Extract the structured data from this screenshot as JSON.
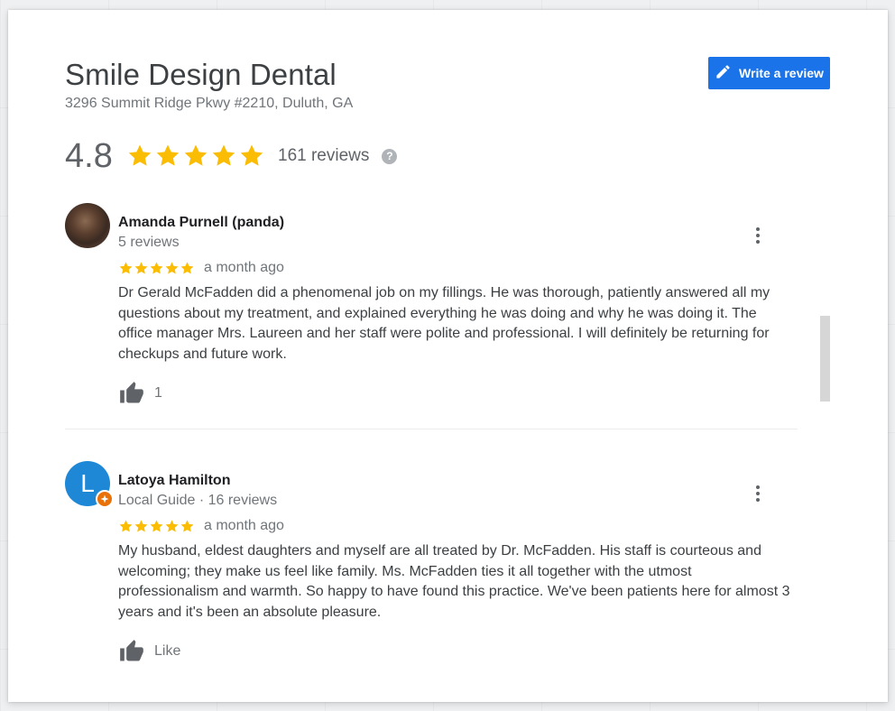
{
  "place": {
    "name": "Smile Design Dental",
    "address": "3296 Summit Ridge Pkwy #2210, Duluth, GA",
    "rating": "4.8",
    "rating_value": 4.8,
    "reviews_count_label": "161 reviews",
    "help_icon": "?"
  },
  "actions": {
    "write_review_label": "Write a review"
  },
  "colors": {
    "accent": "#1a73e8",
    "star": "#fbbc04",
    "guide_badge": "#e8710a",
    "avatar_letter_bg": "#1e88d7"
  },
  "reviews": [
    {
      "author": "Amanda Purnell (panda)",
      "meta": "5 reviews",
      "stars": 5,
      "date": "a month ago",
      "text": "Dr Gerald McFadden did a phenomenal job on my fillings. He was thorough, patiently answered all my questions about my treatment, and explained everything he was doing and why he was doing it. The office manager Mrs. Laureen and her staff were polite and professional. I will definitely be returning for checkups and future work.",
      "like_label": "1"
    },
    {
      "author": "Latoya Hamilton",
      "avatar_letter": "L",
      "meta": "Local Guide · 16 reviews",
      "stars": 5,
      "date": "a month ago",
      "text": "My husband, eldest daughters and myself are all treated by Dr. McFadden. His staff is courteous and welcoming; they make us feel like family. Ms. McFadden ties it all together with the utmost professionalism and warmth. So happy to have found this practice. We've been patients here for almost 3 years and it's been an absolute pleasure.",
      "like_label": "Like"
    }
  ]
}
